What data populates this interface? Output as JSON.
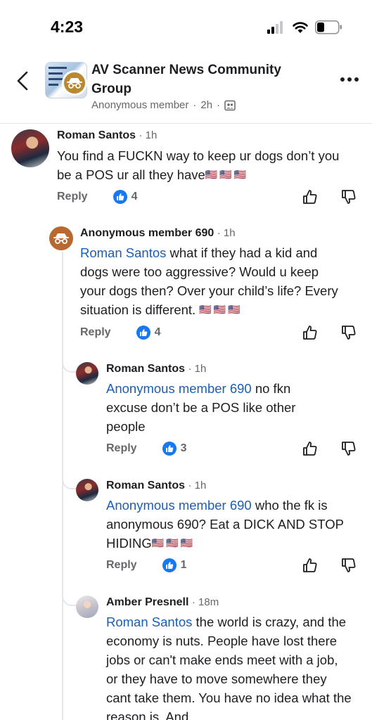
{
  "status_bar": {
    "time": "4:23"
  },
  "header": {
    "group_name": "AV Scanner News Community Group",
    "poster": "Anonymous member",
    "age": "2h",
    "separator": "·"
  },
  "comments": [
    {
      "author": "Roman Santos",
      "time": "· 1h",
      "mention": "",
      "text": "You find a FUCKN way to keep ur dogs don’t you be a POS ur all they have",
      "flags": "🇺🇸🇺🇸🇺🇸",
      "reply_label": "Reply",
      "likes": "4"
    },
    {
      "author": "Anonymous member 690",
      "time": "· 1h",
      "mention": "Roman Santos",
      "text": " what if they had a kid and dogs were too aggressive? Would u keep your dogs then? Over your child’s life? Every situation is different. ",
      "flags": "🇺🇸🇺🇸🇺🇸",
      "reply_label": "Reply",
      "likes": "4"
    },
    {
      "author": "Roman Santos",
      "time": "· 1h",
      "mention": "Anonymous member 690",
      "text": " no fkn excuse don’t be a POS like other people",
      "flags": "",
      "reply_label": "Reply",
      "likes": "3"
    },
    {
      "author": "Roman Santos",
      "time": "· 1h",
      "mention": "Anonymous member 690",
      "text": " who the fk is anonymous 690? Eat a DICK AND STOP HIDING",
      "flags": "🇺🇸🇺🇸🇺🇸",
      "reply_label": "Reply",
      "likes": "1"
    },
    {
      "author": "Amber Presnell",
      "time": "· 18m",
      "mention": "Roman Santos",
      "text": "  the world is crazy, and the economy is nuts. People have lost there jobs or can't make ends meet with a job, or they have to move somewhere they cant take them. You have no idea what the reason is. And",
      "flags": "",
      "reply_label": "",
      "likes": ""
    }
  ]
}
